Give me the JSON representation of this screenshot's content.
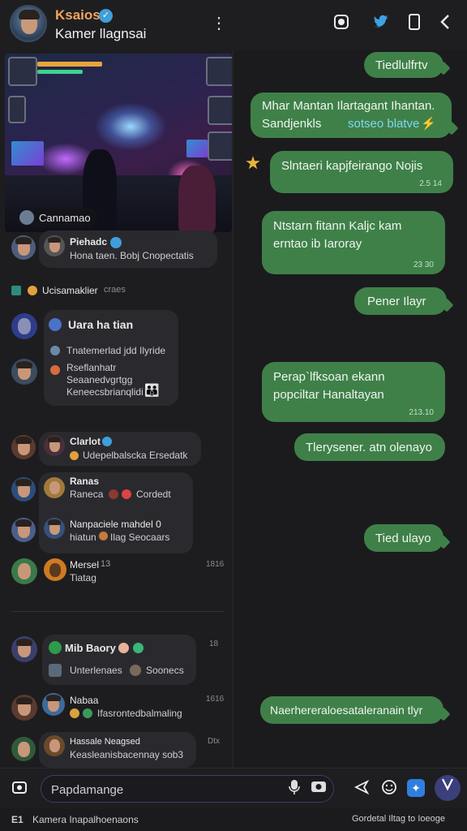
{
  "header": {
    "name_top": "Ksaios",
    "verified_badge": "✓",
    "name_bottom": "Kamer llagnsai",
    "menu_icon": "kebab-icon",
    "icons": [
      "camera-icon",
      "twitter-icon",
      "phone-icon",
      "back-chevron-icon"
    ]
  },
  "left": {
    "hero": {
      "caption": "Cannamao"
    },
    "rows": [
      {
        "title": "Piehadc",
        "line": "Hona taen. Bobj Cnopectatis"
      },
      {
        "title": "Ucisamaklier",
        "tag": "craes"
      },
      {
        "title": "Uara ha tian",
        "lines": [
          "Tnatemerlad jdd Ilyride",
          "Rseflanhatr",
          "Seaanedvgrtgg",
          "Keneecsbrianqlidi"
        ]
      },
      {
        "title": "Clarlot",
        "line": "Udepelbalscka Ersedatk"
      },
      {
        "title": "Ranas",
        "line": "Raneca",
        "extra": "Cordedt"
      },
      {
        "title": "Nanpaciele mahdel 0",
        "line": "hiatun",
        "extra": "Ilag Seocaars"
      },
      {
        "title": "Mersel",
        "num": "13",
        "line": "Tiatag",
        "time": "1816"
      },
      {
        "title": "Mib Baory",
        "line": "Unterlenaes",
        "extra": "Soonecs",
        "time": "18"
      },
      {
        "title": "Nabaa",
        "line": "Ifasrontedbalmaling",
        "time": "1616"
      },
      {
        "title": "Hassale Neagsed",
        "line": "Keasleanisbacennay sob3",
        "time": "Dtx"
      }
    ]
  },
  "right": {
    "messages": [
      {
        "text": "Tiedlulfrtv",
        "time": ""
      },
      {
        "text": "Mhar Mantan Ilartagant Ihantan.",
        "text2": "Sandjenkls",
        "hl": "sotseo blatve",
        "time": ""
      },
      {
        "text": "Slntaeri kapjfeirango Nojis",
        "time": "2.5 14"
      },
      {
        "text": "Ntstarn fitann Kaljc kam",
        "text2": "erntao ib Iaroray",
        "time": "23 30"
      },
      {
        "text": "Pener Ilayr",
        "time": ""
      },
      {
        "text": "Perap`lfksoan ekann",
        "text2": "popciltar Hanaltayan",
        "time": "213.10"
      },
      {
        "text": "Tlerysener. atn olenayo",
        "time": ""
      },
      {
        "text": "Tied ulayo",
        "time": ""
      },
      {
        "text": "Naerhereraloesataleranain tlyr",
        "time": ""
      }
    ]
  },
  "composer": {
    "placeholder": "Papdamange"
  },
  "footer": {
    "left": "Kamera Inapalhoenaons",
    "right": "Gordetal Iltag to Ioeoge",
    "left_icon": "E1"
  }
}
